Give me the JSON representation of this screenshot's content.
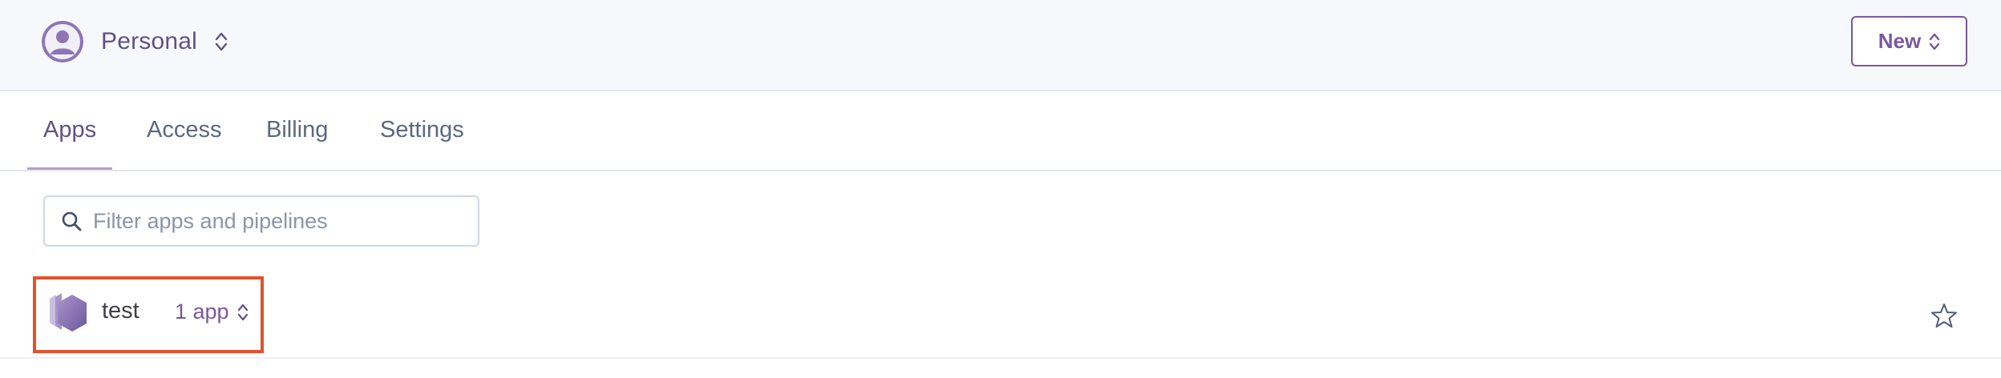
{
  "header": {
    "account_name": "Personal",
    "avatar_icon": "user-avatar-icon",
    "new_button_label": "New"
  },
  "tabs": [
    {
      "label": "Apps",
      "active": true
    },
    {
      "label": "Access",
      "active": false
    },
    {
      "label": "Billing",
      "active": false
    },
    {
      "label": "Settings",
      "active": false
    }
  ],
  "filter": {
    "placeholder": "Filter apps and pipelines",
    "value": "",
    "icon": "search-icon"
  },
  "pipelines": [
    {
      "name": "test",
      "app_count": "1 app",
      "icon": "pipeline-icon",
      "favorite_icon": "star-icon",
      "favorited": false,
      "highlighted": true
    }
  ],
  "colors": {
    "brand_purple": "#79589f",
    "text_purple": "#605185",
    "highlight": "#e4512b",
    "header_bg": "#f7f8fb"
  }
}
